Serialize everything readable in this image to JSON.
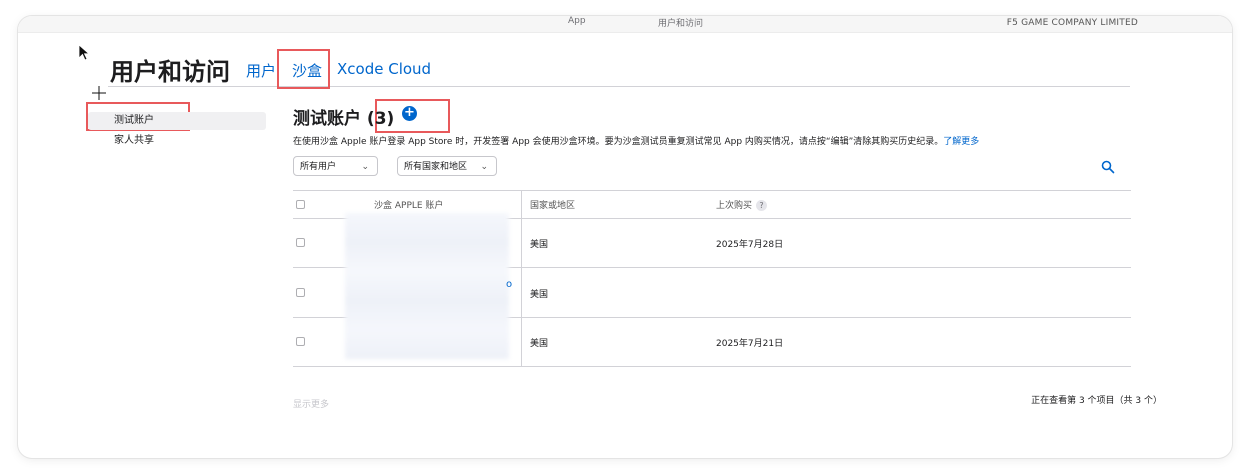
{
  "topbar": {
    "app_link": "App",
    "users_link": "用户和访问",
    "company": "F5 GAME COMPANY LIMITED"
  },
  "page": {
    "title": "用户和访问",
    "tabs": [
      {
        "label": "用户"
      },
      {
        "label": "沙盒",
        "active": true
      },
      {
        "label": "Xcode Cloud"
      }
    ]
  },
  "sidebar": {
    "items": [
      {
        "label": "测试账户",
        "active": true
      },
      {
        "label": "家人共享"
      }
    ]
  },
  "section": {
    "title": "测试账户 (3)",
    "add_icon": "plus-circle-icon",
    "description": "在使用沙盒 Apple 账户登录 App Store 时，开发签署 App 会使用沙盒环境。要为沙盒测试员重复测试常见 App 内购买情况，请点按“编辑”清除其购买历史纪录。",
    "learn_more": "了解更多"
  },
  "filters": {
    "users": "所有用户",
    "regions": "所有国家和地区",
    "search_icon": "search-icon"
  },
  "table": {
    "headers": [
      "沙盒 APPLE 账户",
      "国家或地区",
      "上次购买"
    ],
    "help_badge": "?",
    "rows": [
      {
        "country": "美国",
        "last_purchase": "2025年7月28日"
      },
      {
        "country": "美国",
        "last_purchase": ""
      },
      {
        "country": "美国",
        "last_purchase": "2025年7月21日"
      }
    ]
  },
  "footer": {
    "show_more": "显示更多",
    "viewing": "正在查看第 3 个项目（共 3 个）"
  },
  "colors": {
    "accent": "#0066cc",
    "highlight": "#e8595b"
  }
}
